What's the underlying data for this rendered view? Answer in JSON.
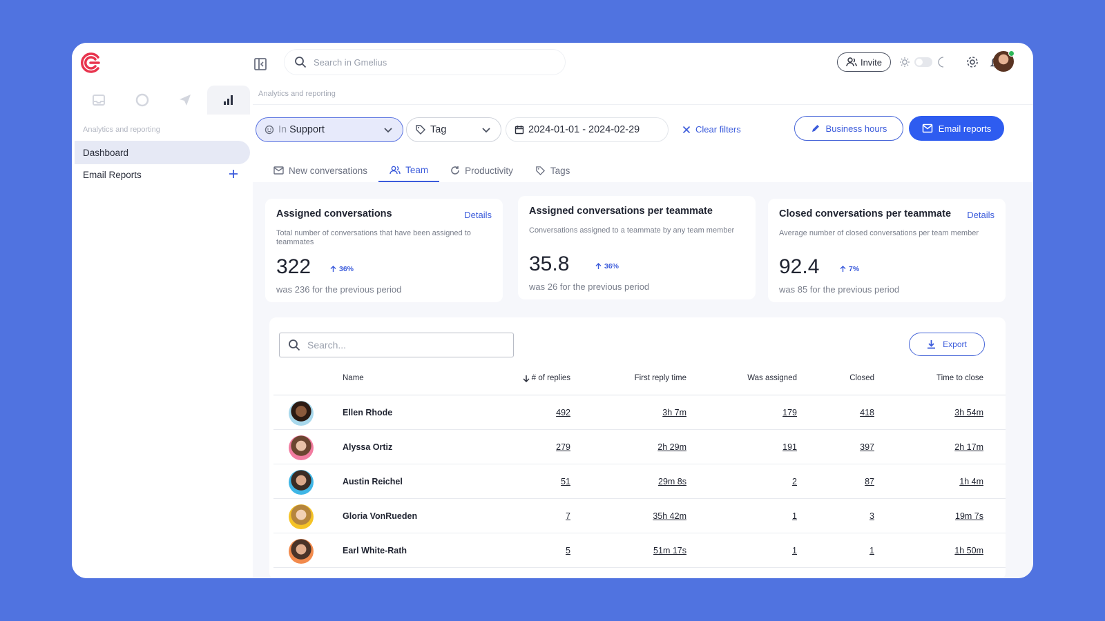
{
  "topbar": {
    "search_placeholder": "Search in Gmelius",
    "invite_label": "Invite"
  },
  "sidebar": {
    "section_label": "Analytics and reporting",
    "items": [
      {
        "label": "Dashboard",
        "active": true
      },
      {
        "label": "Email Reports",
        "active": false
      }
    ]
  },
  "breadcrumb": "Analytics and reporting",
  "filters": {
    "inbox_prefix": "In",
    "inbox_value": "Support",
    "tag_label": "Tag",
    "date_range": "2024-01-01 - 2024-02-29",
    "clear_label": "Clear filters",
    "business_hours_label": "Business hours",
    "email_reports_label": "Email reports"
  },
  "tabs": [
    {
      "label": "New conversations",
      "icon": "mail-icon",
      "active": false
    },
    {
      "label": "Team",
      "icon": "team-icon",
      "active": true
    },
    {
      "label": "Productivity",
      "icon": "refresh-icon",
      "active": false
    },
    {
      "label": "Tags",
      "icon": "tag-icon",
      "active": false
    }
  ],
  "stats": [
    {
      "title": "Assigned conversations",
      "details": "Details",
      "desc": "Total number of conversations that have been assigned to teammates",
      "value": "322",
      "delta": "36%",
      "prev": "was 236 for the previous period"
    },
    {
      "title": "Assigned conversations per teammate",
      "details": "",
      "desc": "Conversations assigned to a teammate by any team member",
      "value": "35.8",
      "delta": "36%",
      "prev": "was 26 for the previous period"
    },
    {
      "title": "Closed conversations per teammate",
      "details": "Details",
      "desc": "Average number of closed conversations per team member",
      "value": "92.4",
      "delta": "7%",
      "prev": "was 85 for the previous period"
    }
  ],
  "table": {
    "search_placeholder": "Search...",
    "export_label": "Export",
    "columns": [
      "Name",
      "# of replies",
      "First reply time",
      "Was assigned",
      "Closed",
      "Time to close"
    ],
    "rows": [
      {
        "name": "Ellen Rhode",
        "replies": "492",
        "first_reply": "3h 7m",
        "assigned": "179",
        "closed": "418",
        "time_to_close": "3h 54m"
      },
      {
        "name": "Alyssa Ortiz",
        "replies": "279",
        "first_reply": "2h 29m",
        "assigned": "191",
        "closed": "397",
        "time_to_close": "2h 17m"
      },
      {
        "name": "Austin Reichel",
        "replies": "51",
        "first_reply": "29m 8s",
        "assigned": "2",
        "closed": "87",
        "time_to_close": "1h 4m"
      },
      {
        "name": "Gloria VonRueden",
        "replies": "7",
        "first_reply": "35h 42m",
        "assigned": "1",
        "closed": "3",
        "time_to_close": "19m 7s"
      },
      {
        "name": "Earl White-Rath",
        "replies": "5",
        "first_reply": "51m 17s",
        "assigned": "1",
        "closed": "1",
        "time_to_close": "1h 50m"
      }
    ]
  },
  "colors": {
    "accent": "#3b5bdb",
    "primary_button": "#2e5cf0",
    "brand": "#e8344e",
    "background": "#5073e0"
  }
}
